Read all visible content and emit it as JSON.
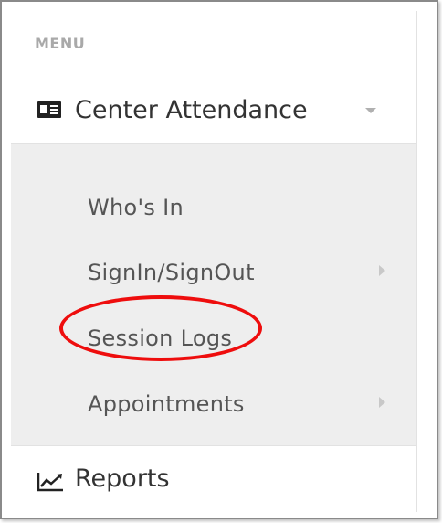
{
  "menu": {
    "heading": "MENU",
    "section": {
      "title": "Center Attendance",
      "icon": "id-card-icon",
      "expanded": true,
      "items": [
        {
          "label": "Who's In",
          "has_submenu": false
        },
        {
          "label": "SignIn/SignOut",
          "has_submenu": true
        },
        {
          "label": "Session Logs",
          "has_submenu": false,
          "highlighted": true
        },
        {
          "label": "Appointments",
          "has_submenu": true
        }
      ]
    },
    "reports": {
      "label": "Reports",
      "icon": "line-chart-icon"
    }
  },
  "colors": {
    "heading": "#a9a9a9",
    "section_text": "#333333",
    "submenu_bg": "#eeeeee",
    "submenu_text": "#555555",
    "annotation": "#ee0d0d"
  }
}
